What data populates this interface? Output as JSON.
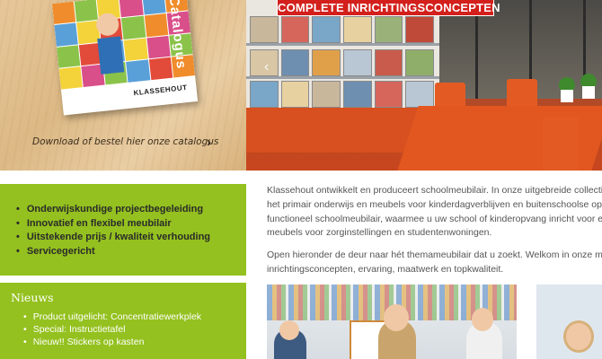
{
  "hero": {
    "catalog": {
      "brochure_title": "Catalogus",
      "brochure_brand": "KLASSEHOUT",
      "download_text": "Download of bestel hier onze catalogus",
      "chevron_icon": "chevron-right-icon"
    },
    "banner": {
      "part1": "COMPLETE ",
      "part2": "INRICHTINGSCONCEPTEN"
    },
    "slider_prev_icon": "chevron-left-icon"
  },
  "features": {
    "items": [
      "Onderwijskundige projectbegeleiding",
      "Innovatief en flexibel meubilair",
      "Uitstekende prijs / kwaliteit verhouding",
      "Servicegericht"
    ]
  },
  "intro": {
    "paragraph1_lines": [
      "Klassehout ontwikkelt en produceert schoolmeubilair. In onze uitgebreide collectie",
      "het primair onderwijs en meubels voor kinderdagverblijven en buitenschoolse opvang",
      "functioneel schoolmeubilair, waarmee u uw school of kinderopvang inricht voor een",
      "meubels voor zorginstellingen en studentenwoningen."
    ],
    "paragraph2_lines": [
      "Open hieronder de deur naar hét themameubilair dat u zoekt. Welkom in onze meub",
      "inrichtingsconcepten, ervaring, maatwerk en topkwaliteit."
    ]
  },
  "news": {
    "heading": "Nieuws",
    "items": [
      "Product uitgelicht: Concentratiewerkplek",
      "Special: Instructietafel",
      "Nieuw!! Stickers op kasten"
    ]
  },
  "colors": {
    "accent_green": "#94c11f",
    "banner_red": "#d3201c",
    "furniture_orange": "#d8501f"
  }
}
